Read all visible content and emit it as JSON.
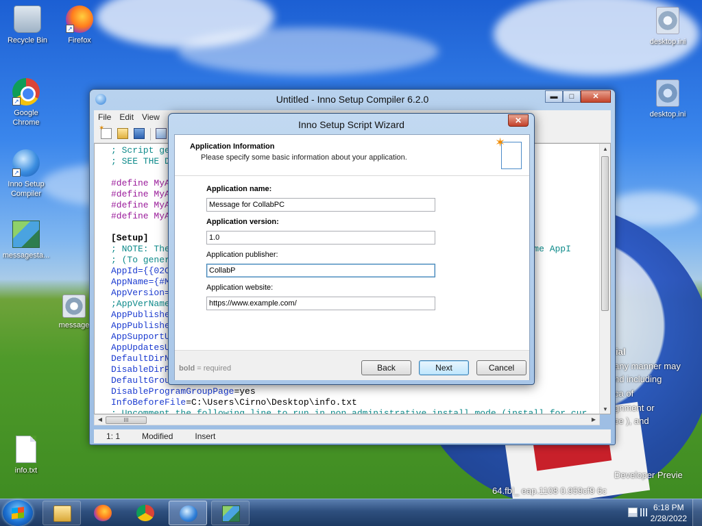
{
  "desktop": {
    "icons": [
      {
        "label": "Recycle Bin",
        "icon": "recycle-bin-icon"
      },
      {
        "label": "Firefox",
        "icon": "firefox-icon"
      },
      {
        "label": "Google Chrome",
        "icon": "chrome-icon"
      },
      {
        "label": "Inno Setup Compiler",
        "icon": "inno-setup-icon"
      },
      {
        "label": "messagesta...",
        "icon": "registry-file-icon"
      },
      {
        "label": "message",
        "icon": "settings-file-icon"
      },
      {
        "label": "info.txt",
        "icon": "text-file-icon"
      },
      {
        "label": "desktop.ini",
        "icon": "settings-file-icon"
      },
      {
        "label": "desktop.ini",
        "icon": "settings-file-icon"
      }
    ],
    "watermark_lines": [
      "ial",
      "any manner may",
      "nd including",
      "ca  of",
      "gnment or",
      "ce ), and"
    ],
    "build_lines": [
      "Developer Previe",
      "64.fbl_  eap.1108      0.959cf9    6c"
    ]
  },
  "main_window": {
    "title": "Untitled - Inno Setup Compiler 6.2.0",
    "caption_buttons": {
      "minimize": "▬",
      "maximize": "□",
      "close": "✕"
    },
    "menu": [
      "File",
      "Edit",
      "View"
    ],
    "code_lines": [
      {
        "type": "comment",
        "text": "; Script ge"
      },
      {
        "type": "comment",
        "text": "; SEE THE D"
      },
      {
        "type": "blank",
        "text": ""
      },
      {
        "type": "directive",
        "text": "#define MyA"
      },
      {
        "type": "directive",
        "text": "#define MyA"
      },
      {
        "type": "directive",
        "text": "#define MyA"
      },
      {
        "type": "directive",
        "text": "#define MyA"
      },
      {
        "type": "blank",
        "text": ""
      },
      {
        "type": "section",
        "text": "[Setup]"
      },
      {
        "type": "comment",
        "text": "; NOTE: The                                                               he same AppI"
      },
      {
        "type": "comment",
        "text": "; (To gener"
      },
      {
        "type": "key",
        "text": "AppId={{02C"
      },
      {
        "type": "key",
        "text": "AppName={#M"
      },
      {
        "type": "key",
        "text": "AppVersion="
      },
      {
        "type": "comment",
        "text": ";AppVerName"
      },
      {
        "type": "key",
        "text": "AppPublishe"
      },
      {
        "type": "key",
        "text": "AppPublishe"
      },
      {
        "type": "key",
        "text": "AppSupportU"
      },
      {
        "type": "key",
        "text": "AppUpdatesU"
      },
      {
        "type": "key",
        "text": "DefaultDirN"
      },
      {
        "type": "key",
        "text": "DisableDirP"
      },
      {
        "type": "key",
        "text": "DefaultGrou"
      },
      {
        "type": "mixed",
        "key": "DisableProgramGroupPage",
        "value": "=yes"
      },
      {
        "type": "mixed",
        "key": "InfoBeforeFile",
        "value": "=C:\\Users\\Cirno\\Desktop\\info.txt"
      },
      {
        "type": "comment",
        "text": "; Uncomment the following line to run in non administrative install mode (install for cur"
      }
    ],
    "hscroll_thumb": "III",
    "status": {
      "position": "1:  1",
      "modified": "Modified",
      "mode": "Insert"
    }
  },
  "wizard": {
    "title": "Inno Setup Script Wizard",
    "close": "✕",
    "heading": "Application Information",
    "subheading": "Please specify some basic information about your application.",
    "fields": [
      {
        "label": "Application name:",
        "value": "Message for CollabPC",
        "required": true
      },
      {
        "label": "Application version:",
        "value": "1.0",
        "required": true
      },
      {
        "label": "Application publisher:",
        "value": "CollabP",
        "required": false
      },
      {
        "label": "Application website:",
        "value": "https://www.example.com/",
        "required": false
      }
    ],
    "required_note_bold": "bold",
    "required_note_rest": " = required",
    "buttons": {
      "back": "Back",
      "next": "Next",
      "cancel": "Cancel"
    }
  },
  "taskbar": {
    "apps": [
      "windows-explorer",
      "firefox",
      "chrome",
      "inno-setup-compiler",
      "registry-editor"
    ],
    "clock_time": "6:18 PM",
    "clock_date": "2/28/2022"
  },
  "colors": {
    "comment": "#0d8a8a",
    "directive": "#9b1b9b",
    "key": "#1a3ad0",
    "accent": "#3c7fb1"
  }
}
